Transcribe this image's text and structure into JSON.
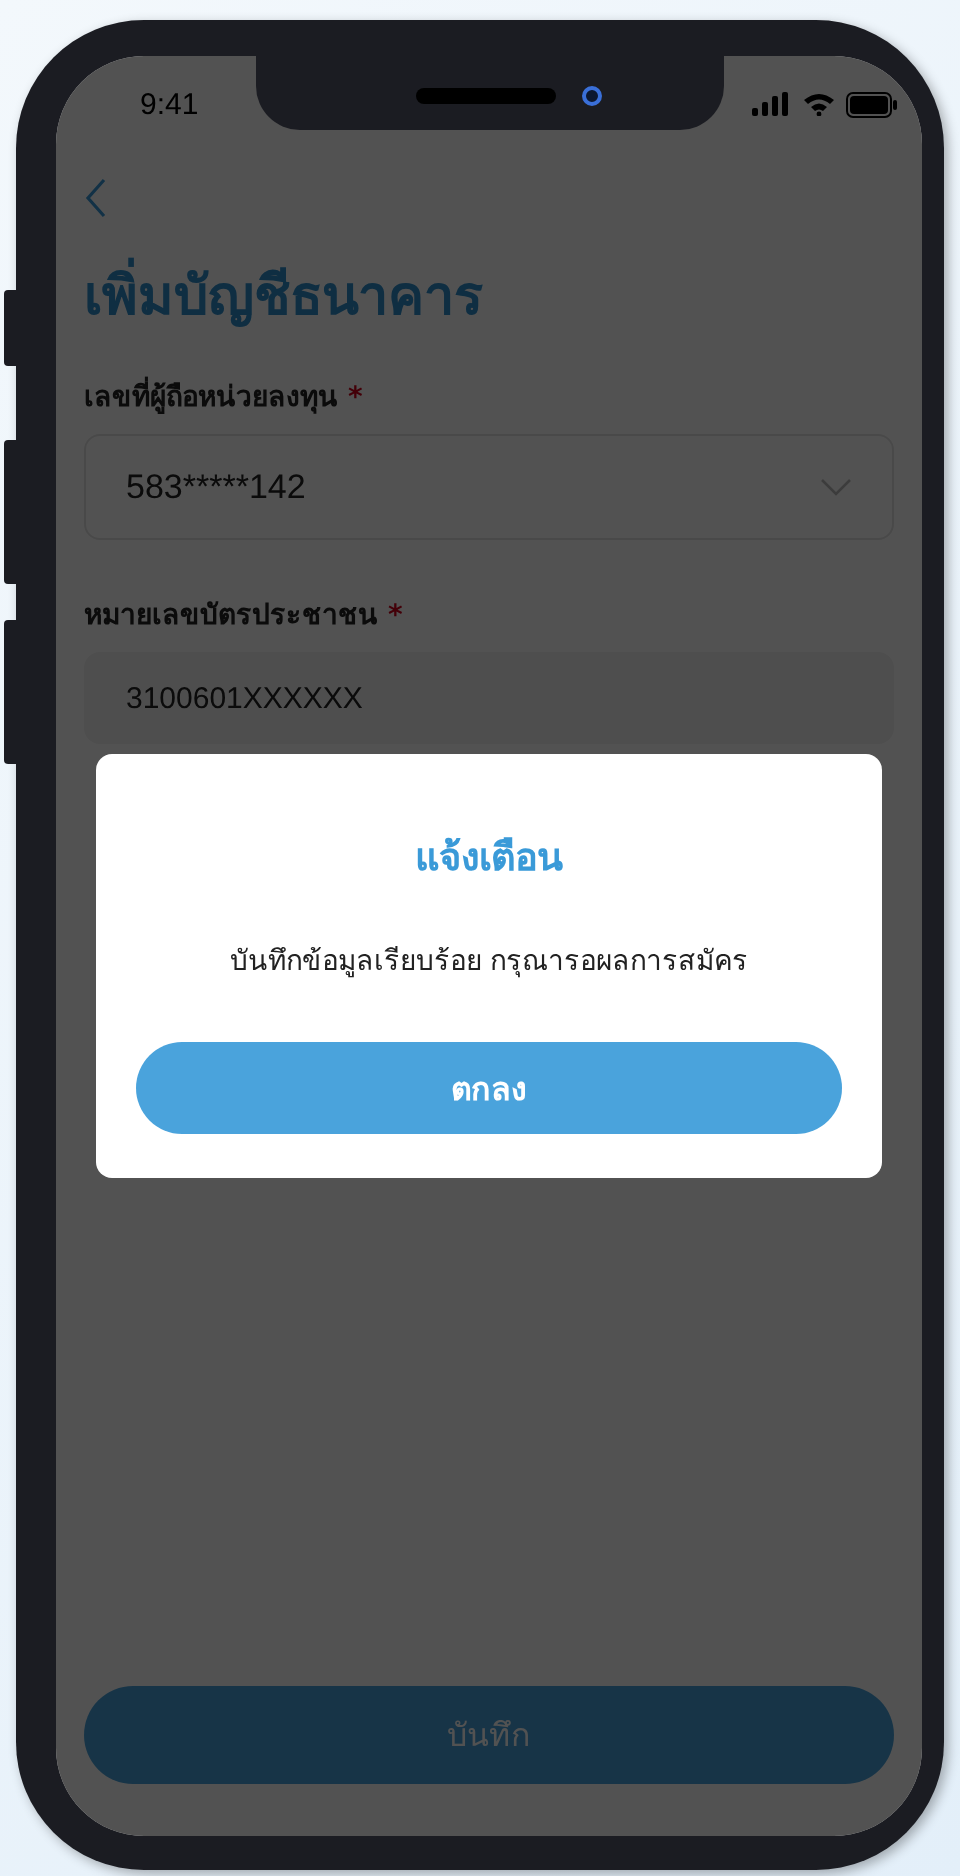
{
  "status_bar": {
    "time": "9:41"
  },
  "page": {
    "title": "เพิ่มบัญชีธนาคาร"
  },
  "fields": [
    {
      "label": "เลขที่ผู้ถือหน่วยลงทุน",
      "mark": "*",
      "kind": "select",
      "value": "583*****142"
    },
    {
      "label": "หมายเลขบัตรประชาชน",
      "mark": "*",
      "kind": "readonly",
      "value": "3100601XXXXXX"
    }
  ],
  "save_button": {
    "label": "บันทึก"
  },
  "dialog": {
    "title": "แจ้งเตือน",
    "message": "บันทึกข้อมูลเรียบร้อย กรุณารอผลการสมัคร",
    "button": "ตกลง"
  }
}
